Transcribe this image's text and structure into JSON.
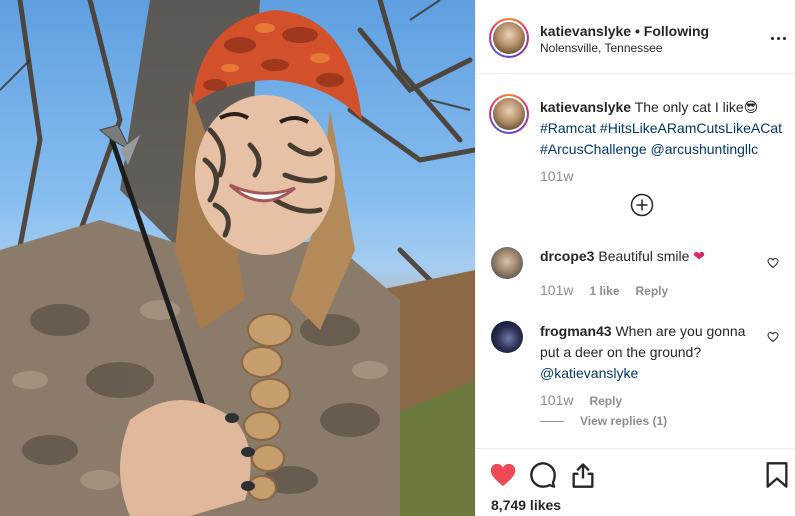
{
  "post": {
    "author": "katievanslyke",
    "separator": "•",
    "follow_status": "Following",
    "location": "Nolensville, Tennessee"
  },
  "caption": {
    "username": "katievanslyke",
    "text": "The only cat I like",
    "emoji": "😎",
    "hashtags": [
      "#Ramcat",
      "#HitsLikeARamCutsLikeACat",
      "#ArcusChallenge"
    ],
    "mention": "@arcushuntingllc",
    "time": "101w"
  },
  "comments": [
    {
      "username": "drcope3",
      "text": "Beautiful smile",
      "emoji": "❤️",
      "time": "101w",
      "likes": "1 like",
      "reply_label": "Reply"
    },
    {
      "username": "frogman43",
      "text": "When are you gonna put a deer on the ground?",
      "mention": "@katievanslyke",
      "time": "101w",
      "reply_label": "Reply",
      "view_replies": "View replies (1)"
    }
  ],
  "actions": {
    "likes_count": "8,749 likes"
  },
  "icons": {
    "more": "more-options-icon",
    "load_more": "plus-circle-icon",
    "comment_like": "heart-outline-icon",
    "like": "heart-filled-icon",
    "comment": "speech-bubble-icon",
    "share": "share-upload-icon",
    "save": "bookmark-icon"
  },
  "colors": {
    "like_red": "#ed4956",
    "text_dark": "#262626",
    "text_muted": "#8e8e8e",
    "link_blue": "#00376b"
  }
}
